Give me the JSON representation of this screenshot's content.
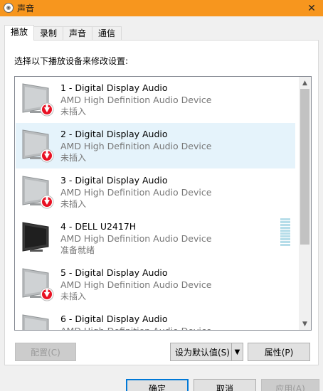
{
  "window": {
    "title": "声音",
    "close_label": "✕"
  },
  "tabs": [
    {
      "label": "播放"
    },
    {
      "label": "录制"
    },
    {
      "label": "声音"
    },
    {
      "label": "通信"
    }
  ],
  "instruction": "选择以下播放设备来修改设置:",
  "devices": [
    {
      "name": "1 - Digital Display Audio",
      "desc": "AMD High Definition Audio Device",
      "status": "未插入",
      "icon": "monitor-unplugged-icon"
    },
    {
      "name": "2 - Digital Display Audio",
      "desc": "AMD High Definition Audio Device",
      "status": "未插入",
      "icon": "monitor-unplugged-icon"
    },
    {
      "name": "3 - Digital Display Audio",
      "desc": "AMD High Definition Audio Device",
      "status": "未插入",
      "icon": "monitor-unplugged-icon"
    },
    {
      "name": "4 - DELL U2417H",
      "desc": "AMD High Definition Audio Device",
      "status": "准备就绪",
      "icon": "monitor-ready-icon"
    },
    {
      "name": "5 - Digital Display Audio",
      "desc": "AMD High Definition Audio Device",
      "status": "未插入",
      "icon": "monitor-unplugged-icon"
    },
    {
      "name": "6 - Digital Display Audio",
      "desc": "AMD High Definition Audio Device",
      "status": "",
      "icon": "monitor-unplugged-icon"
    }
  ],
  "buttons": {
    "configure": "配置(C)",
    "set_default": "设为默认值(S)",
    "properties": "属性(P)",
    "ok": "确定",
    "cancel": "取消",
    "apply": "应用(A)"
  },
  "colors": {
    "titlebar": "#f7961e",
    "selection": "#e5f3fb",
    "unplugged_badge": "#e81123",
    "accent": "#0078d7"
  }
}
